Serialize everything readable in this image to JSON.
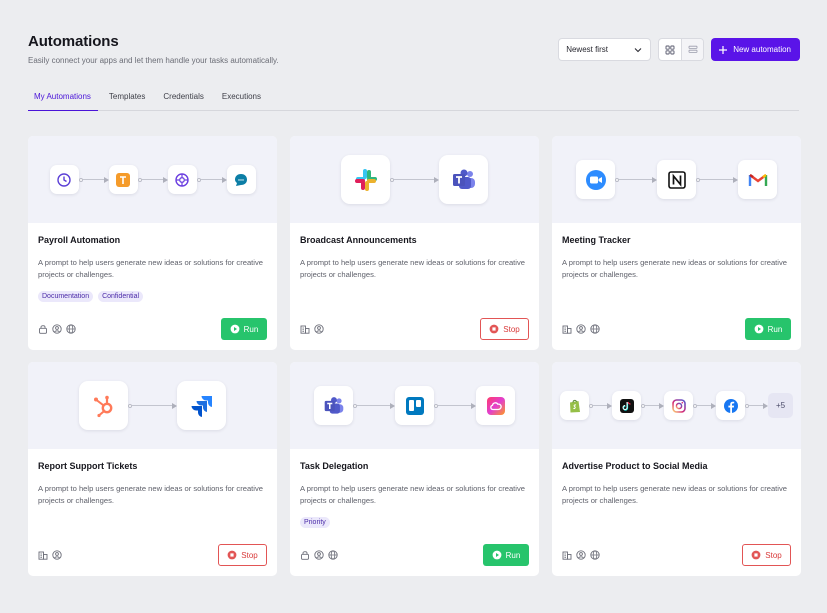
{
  "header": {
    "title": "Automations",
    "subtitle": "Easily connect your apps and let them handle your tasks automatically."
  },
  "toolbar": {
    "sort_value": "Newest first",
    "new_button_label": "New automation",
    "accent_color": "#5a14e8"
  },
  "tabs": [
    {
      "label": "My Automations",
      "active": true
    },
    {
      "label": "Templates",
      "active": false
    },
    {
      "label": "Credentials",
      "active": false
    },
    {
      "label": "Executions",
      "active": false
    }
  ],
  "cards": [
    {
      "title": "Payroll Automation",
      "description": "A prompt to help users generate new ideas or solutions for creative projects or challenges.",
      "tags": [
        "Documentation",
        "Confidential"
      ],
      "apps": [
        "clock-icon",
        "t-app-icon",
        "settings-icon",
        "chat-icon"
      ],
      "meta": [
        "lock-icon",
        "user-icon",
        "globe-icon"
      ],
      "action": "Run"
    },
    {
      "title": "Broadcast Announcements",
      "description": "A prompt to help users generate new ideas or solutions for creative projects or challenges.",
      "tags": [],
      "apps": [
        "slack-icon",
        "teams-icon"
      ],
      "meta": [
        "building-icon",
        "user-icon"
      ],
      "action": "Stop"
    },
    {
      "title": "Meeting Tracker",
      "description": "A prompt to help users generate new ideas or solutions for creative projects or challenges.",
      "tags": [],
      "apps": [
        "zoom-icon",
        "notion-icon",
        "gmail-icon"
      ],
      "meta": [
        "building-icon",
        "user-icon",
        "globe-icon"
      ],
      "action": "Run"
    },
    {
      "title": "Report Support Tickets",
      "description": "A prompt to help users generate new ideas or solutions for creative projects or challenges.",
      "tags": [],
      "apps": [
        "hubspot-icon",
        "jira-icon"
      ],
      "meta": [
        "building-icon",
        "user-icon"
      ],
      "action": "Stop"
    },
    {
      "title": "Task Delegation",
      "description": "A prompt to help users generate new ideas or solutions for creative projects or challenges.",
      "tags": [
        "Priority"
      ],
      "apps": [
        "teams-icon",
        "trello-icon",
        "creative-cloud-icon"
      ],
      "meta": [
        "lock-icon",
        "user-icon",
        "globe-icon"
      ],
      "action": "Run"
    },
    {
      "title": "Advertise Product to Social Media",
      "description": "A prompt to help users generate new ideas or solutions for creative projects or challenges.",
      "tags": [],
      "apps": [
        "shopify-icon",
        "tiktok-icon",
        "instagram-icon",
        "facebook-icon"
      ],
      "more_apps": "+5",
      "meta": [
        "building-icon",
        "user-icon",
        "globe-icon"
      ],
      "action": "Stop"
    }
  ],
  "colors": {
    "run": "#27c46c",
    "stop": "#e25555",
    "tag_bg": "#ebe8fb"
  }
}
